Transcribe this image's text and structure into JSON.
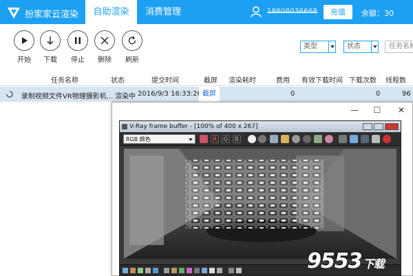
{
  "header": {
    "brand": "扮家家云渲染",
    "tabs": [
      {
        "label": "自助渲染",
        "active": true
      },
      {
        "label": "消费管理",
        "active": false
      }
    ],
    "phone": "18608036668",
    "recharge_label": "充值",
    "balance": "余额：30"
  },
  "toolbar": {
    "buttons": [
      {
        "label": "开始",
        "icon": "play-icon"
      },
      {
        "label": "下载",
        "icon": "download-arrow-icon"
      },
      {
        "label": "停止",
        "icon": "pause-icon"
      },
      {
        "label": "删除",
        "icon": "close-icon"
      },
      {
        "label": "刷新",
        "icon": "refresh-icon"
      }
    ],
    "filters": {
      "type": "类型",
      "status": "状态",
      "search_placeholder": "任务名称"
    }
  },
  "table": {
    "columns": [
      "任务名称",
      "状态",
      "提交时间",
      "截屏",
      "渲染耗时",
      "费用",
      "有效下载时间",
      "下载次数",
      "线程数"
    ],
    "rows": [
      {
        "name": "录制视频文件VR物理摄影机...",
        "status": "渲染中",
        "submitted": "2016/9/3 16:33:26",
        "screenshot": "截屏",
        "render_time": "",
        "cost": "0",
        "valid_download_time": "",
        "download_count": "0",
        "threads": "96"
      }
    ]
  },
  "window": {
    "controls": [
      "—",
      "☐",
      "✕"
    ],
    "vray_title": "V-Ray frame buffer - [100% of 400 x 267]",
    "channel": "RGB 颜色",
    "tool_buttons": [
      "R",
      "G",
      "B"
    ]
  },
  "watermark": {
    "main": "9553",
    "suffix": "下载"
  },
  "colors": {
    "accent": "#1da0f2",
    "row_selected": "#d7e4f1"
  }
}
